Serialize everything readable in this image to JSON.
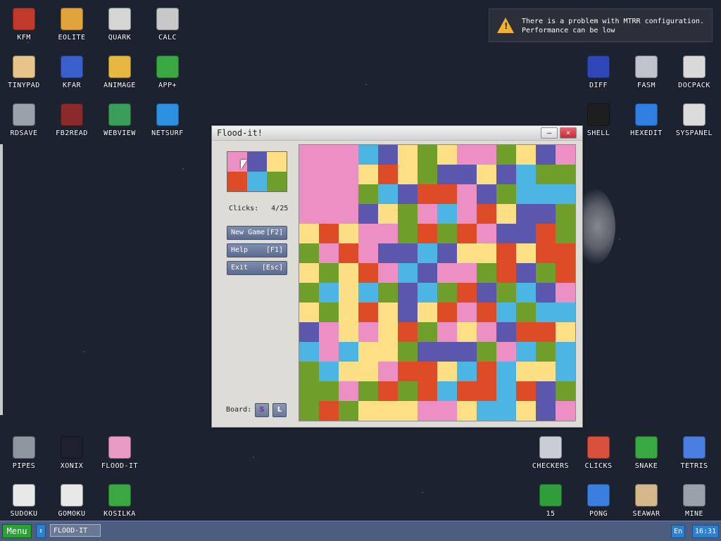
{
  "desktop_icons": [
    {
      "name": "kfm-icon",
      "label": "KFM",
      "col": 0,
      "row": 0,
      "color": "#c0392b"
    },
    {
      "name": "eolite-icon",
      "label": "EOLITE",
      "col": 1,
      "row": 0,
      "color": "#e0a43a"
    },
    {
      "name": "quark-icon",
      "label": "QUARK",
      "col": 2,
      "row": 0,
      "color": "#d5d5d5"
    },
    {
      "name": "calc-icon",
      "label": "CALC",
      "col": 3,
      "row": 0,
      "color": "#c8c8c8"
    },
    {
      "name": "tinypad-icon",
      "label": "TINYPAD",
      "col": 0,
      "row": 1,
      "color": "#e6c48a"
    },
    {
      "name": "kfar-icon",
      "label": "KFAR",
      "col": 1,
      "row": 1,
      "color": "#3a5fcd"
    },
    {
      "name": "animage-icon",
      "label": "ANIMAGE",
      "col": 2,
      "row": 1,
      "color": "#e6b840"
    },
    {
      "name": "app-plus-icon",
      "label": "APP+",
      "col": 3,
      "row": 1,
      "color": "#3aa842"
    },
    {
      "name": "rdsave-icon",
      "label": "RDSAVE",
      "col": 0,
      "row": 2,
      "color": "#9aa1aa"
    },
    {
      "name": "fb2read-icon",
      "label": "FB2READ",
      "col": 1,
      "row": 2,
      "color": "#8a2a2a"
    },
    {
      "name": "webview-icon",
      "label": "WEBVIEW",
      "col": 2,
      "row": 2,
      "color": "#3a9e5a"
    },
    {
      "name": "netsurf-icon",
      "label": "NETSURF",
      "col": 3,
      "row": 2,
      "color": "#2d8fe0"
    },
    {
      "name": "diff-icon",
      "label": "DIFF",
      "col": 12,
      "row": 1,
      "color": "#2f47b8"
    },
    {
      "name": "fasm-icon",
      "label": "FASM",
      "col": 13,
      "row": 1,
      "color": "#bfc4cc"
    },
    {
      "name": "docpack-icon",
      "label": "DOCPACK",
      "col": 14,
      "row": 1,
      "color": "#d9d9d9"
    },
    {
      "name": "shell-icon",
      "label": "SHELL",
      "col": 12,
      "row": 2,
      "color": "#1e1e1e"
    },
    {
      "name": "hexedit-icon",
      "label": "HEXEDIT",
      "col": 13,
      "row": 2,
      "color": "#2f7fe0"
    },
    {
      "name": "syspanel-icon",
      "label": "SYSPANEL",
      "col": 14,
      "row": 2,
      "color": "#dcdcdc"
    },
    {
      "name": "pipes-icon",
      "label": "PIPES",
      "col": 0,
      "row": 9,
      "color": "#8f96a0"
    },
    {
      "name": "xonix-icon",
      "label": "XONIX",
      "col": 1,
      "row": 9,
      "color": "#1f1f2f"
    },
    {
      "name": "flood-it-icon",
      "label": "FLOOD-IT",
      "col": 2,
      "row": 9,
      "color": "#e89bc4"
    },
    {
      "name": "checkers-icon",
      "label": "CHECKERS",
      "col": 11,
      "row": 9,
      "color": "#c9ced6"
    },
    {
      "name": "clicks-icon",
      "label": "CLICKS",
      "col": 12,
      "row": 9,
      "color": "#d9503c"
    },
    {
      "name": "snake-icon",
      "label": "SNAKE",
      "col": 13,
      "row": 9,
      "color": "#3aa842"
    },
    {
      "name": "tetris-icon",
      "label": "TETRIS",
      "col": 14,
      "row": 9,
      "color": "#4a7fe0"
    },
    {
      "name": "sudoku-icon",
      "label": "SUDOKU",
      "col": 0,
      "row": 10,
      "color": "#e8e8e8"
    },
    {
      "name": "gomoku-icon",
      "label": "GOMOKU",
      "col": 1,
      "row": 10,
      "color": "#e8e8e8"
    },
    {
      "name": "kosilka-icon",
      "label": "KOSILKA",
      "col": 2,
      "row": 10,
      "color": "#3aa842"
    },
    {
      "name": "fifteen-icon",
      "label": "15",
      "col": 11,
      "row": 10,
      "color": "#2e9e3a"
    },
    {
      "name": "pong-icon",
      "label": "PONG",
      "col": 12,
      "row": 10,
      "color": "#3a7fe0"
    },
    {
      "name": "seawar-icon",
      "label": "SEAWAR",
      "col": 13,
      "row": 10,
      "color": "#d4b88c"
    },
    {
      "name": "mine-icon",
      "label": "MINE",
      "col": 14,
      "row": 10,
      "color": "#9aa1aa"
    }
  ],
  "notification": {
    "line1": "There is a problem with MTRR configuration.",
    "line2": "Performance can be low",
    "icon": "warning-icon",
    "icon_glyph": "!"
  },
  "window": {
    "title": "Flood-it!",
    "minimize_glyph": "–",
    "close_glyph": "×"
  },
  "game": {
    "palette_colors": [
      "#ec8fc4",
      "#5a57ad",
      "#fddf86",
      "#dd4c26",
      "#4db5e4",
      "#6f9f2a"
    ],
    "clicks_label": "Clicks:",
    "clicks_value": "4/25",
    "new_game_label": "New Game",
    "new_game_key": "[F2]",
    "help_label": "Help",
    "help_key": "[F1]",
    "exit_label": "Exit",
    "exit_key": "[Esc]",
    "board_label": "Board:",
    "board_small": "S",
    "board_large": "L",
    "grid": [
      "PPPBVYGYPPGYVP",
      "PPPYRYGVVYVBGG",
      "PPPGBVRRPVGBBB",
      "PPPVYGPBPRYVVG",
      "YRYPPGRGRPVVRG",
      "GPRPVVBVYYRYRR",
      "YGYRPBVPPGRVGR",
      "GBYBGVBGRVGBVP",
      "YGYRYVYRPRBGBB",
      "VPYPYRGPYPVRRY",
      "BPBYYGVVVGPBGB",
      "GBYYPRRYBRBYYB",
      "GGPGRGRBRRBRVG",
      "GRGYYYPPYBBYVP"
    ]
  },
  "taskbar": {
    "menu_label": "Menu",
    "arrow_glyph": "↕",
    "task_label": "FLOOD-IT",
    "lang": "En",
    "clock": "16:31"
  }
}
